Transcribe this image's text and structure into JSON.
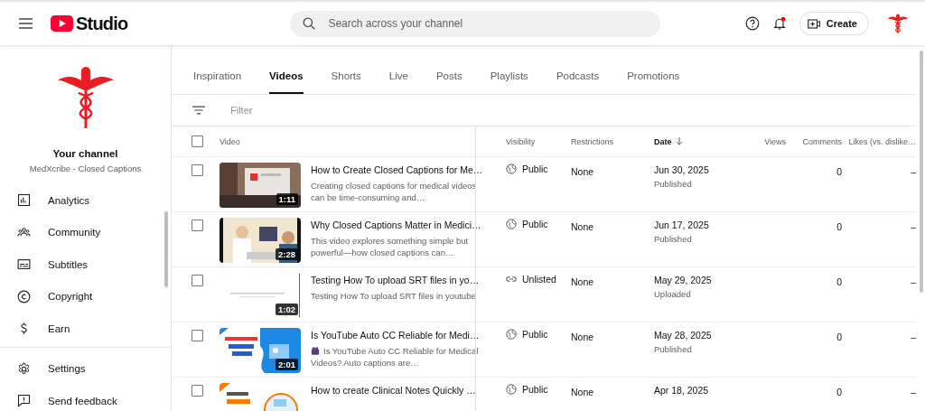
{
  "header": {
    "brand": "Studio",
    "search": {
      "placeholder": "Search across your channel"
    },
    "create_label": "Create"
  },
  "sidebar": {
    "channel_title": "Your channel",
    "channel_name": "MedXcribe - Closed Captions",
    "items": [
      {
        "label": "Analytics",
        "kind": "analytics"
      },
      {
        "label": "Community",
        "kind": "community"
      },
      {
        "label": "Subtitles",
        "kind": "subtitles"
      },
      {
        "label": "Copyright",
        "kind": "copyright"
      },
      {
        "label": "Earn",
        "kind": "earn"
      }
    ],
    "footer_items": [
      {
        "label": "Settings",
        "kind": "settings"
      },
      {
        "label": "Send feedback",
        "kind": "feedback"
      }
    ]
  },
  "tabs": [
    {
      "label": "Inspiration",
      "selected": false
    },
    {
      "label": "Videos",
      "selected": true
    },
    {
      "label": "Shorts",
      "selected": false
    },
    {
      "label": "Live",
      "selected": false
    },
    {
      "label": "Posts",
      "selected": false
    },
    {
      "label": "Playlists",
      "selected": false
    },
    {
      "label": "Podcasts",
      "selected": false
    },
    {
      "label": "Promotions",
      "selected": false
    }
  ],
  "filter": {
    "placeholder": "Filter"
  },
  "table": {
    "select_all_checked": false,
    "columns": [
      {
        "label": "Video",
        "sorted": false
      },
      {
        "label": "Visibility",
        "sorted": false
      },
      {
        "label": "Restrictions",
        "sorted": false
      },
      {
        "label": "Date",
        "sorted": true
      },
      {
        "label": "Views",
        "sorted": false
      },
      {
        "label": "Comments",
        "sorted": false
      },
      {
        "label": "Likes (vs. dislike…",
        "sorted": false
      }
    ],
    "rows": [
      {
        "checked": false,
        "duration": "1:11",
        "title": "How to Create Closed Captions for Me…",
        "description": "Creating closed captions for medical videos can be time-consuming and…",
        "description_icon": false,
        "visibility": {
          "kind": "public",
          "label": "Public"
        },
        "restrictions": "None",
        "date": "Jun 30, 2025",
        "date_status": "Published",
        "comments": "0",
        "likes": "–"
      },
      {
        "checked": false,
        "duration": "2:28",
        "title": "Why Closed Captions Matter in Medici…",
        "description": "This video explores something simple but powerful—how closed captions can…",
        "description_icon": false,
        "visibility": {
          "kind": "public",
          "label": "Public"
        },
        "restrictions": "None",
        "date": "Jun 17, 2025",
        "date_status": "Published",
        "comments": "0",
        "likes": "–"
      },
      {
        "checked": false,
        "duration": "1:02",
        "title": "Testing How To upload SRT files in yo…",
        "description": "Testing How To upload SRT files in youtube",
        "description_icon": false,
        "visibility": {
          "kind": "unlisted",
          "label": "Unlisted"
        },
        "restrictions": "None",
        "date": "May 29, 2025",
        "date_status": "Uploaded",
        "comments": "0",
        "likes": "–"
      },
      {
        "checked": false,
        "duration": "2:01",
        "title": "Is YouTube Auto CC Reliable for Medi…",
        "description": "Is YouTube Auto CC Reliable for Medical Videos? Auto captions are…",
        "description_icon": true,
        "visibility": {
          "kind": "public",
          "label": "Public"
        },
        "restrictions": "None",
        "date": "May 28, 2025",
        "date_status": "Published",
        "comments": "0",
        "likes": "–"
      },
      {
        "checked": false,
        "title": "How to create Clinical Notes Quickly …",
        "visibility": {
          "kind": "public",
          "label": "Public"
        },
        "restrictions": "None",
        "date": "Apr 18, 2025",
        "comments": "0",
        "likes": "–"
      }
    ]
  }
}
